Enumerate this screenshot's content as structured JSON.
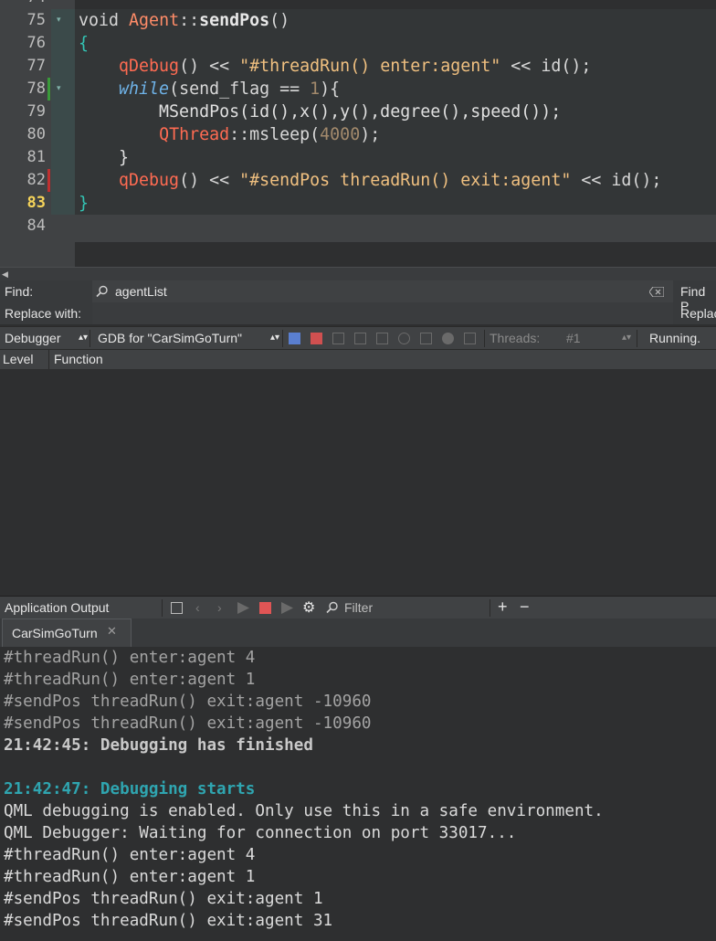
{
  "editor": {
    "prev_line_number": "74",
    "lines": [
      {
        "n": "75"
      },
      {
        "n": "76"
      },
      {
        "n": "77"
      },
      {
        "n": "78"
      },
      {
        "n": "79"
      },
      {
        "n": "80"
      },
      {
        "n": "81"
      },
      {
        "n": "82"
      },
      {
        "n": "83"
      },
      {
        "n": "84"
      }
    ],
    "current_line": "83",
    "code": {
      "l75_void": "void",
      "l75_class": "Agent",
      "l75_sep": "::",
      "l75_fn": "sendPos",
      "l75_paren": "()",
      "l76_brace": "{",
      "l77_indent": "    ",
      "l77_qdebug": "qDebug",
      "l77_mid": "() << ",
      "l77_str": "\"#threadRun() enter:agent\"",
      "l77_tail": " << id();",
      "l78_indent": "    ",
      "l78_while": "while",
      "l78_mid": "(send_flag == ",
      "l78_num": "1",
      "l78_tail": "){",
      "l79_text": "        MSendPos(id(),x(),y(),degree(),speed());",
      "l80_indent": "        ",
      "l80_class": "QThread",
      "l80_mid": "::msleep(",
      "l80_num": "4000",
      "l80_tail": ");",
      "l81_text": "    }",
      "l82_indent": "    ",
      "l82_qdebug": "qDebug",
      "l82_mid": "() << ",
      "l82_str": "\"#sendPos threadRun() exit:agent\"",
      "l82_tail": " << id();",
      "l83_brace": "}"
    }
  },
  "find": {
    "find_label": "Find:",
    "find_value": "agentList",
    "replace_label": "Replace with:",
    "find_prev_label": "Find P",
    "replace_btn_label": "Replac"
  },
  "debugger": {
    "view_selector": "Debugger",
    "engine_selector": "GDB for \"CarSimGoTurn\"",
    "threads_label": "Threads:",
    "thread_value": "#1",
    "status": "Running.",
    "col_level": "Level",
    "col_function": "Function"
  },
  "output": {
    "pane_title": "Application Output",
    "filter_placeholder": "Filter",
    "tab_label": "CarSimGoTurn",
    "lines": [
      {
        "text": "#threadRun() enter:agent 4",
        "style": "old"
      },
      {
        "text": "#threadRun() enter:agent 1",
        "style": "old"
      },
      {
        "text": "#sendPos threadRun() exit:agent -10960",
        "style": "old"
      },
      {
        "text": "#sendPos threadRun() exit:agent -10960",
        "style": "old"
      },
      {
        "text": "21:42:45: Debugging has finished",
        "style": "fin"
      },
      {
        "text": "",
        "style": "norm"
      },
      {
        "text": "21:42:47: Debugging starts",
        "style": "start"
      },
      {
        "text": "QML debugging is enabled. Only use this in a safe environment.",
        "style": "norm"
      },
      {
        "text": "QML Debugger: Waiting for connection on port 33017...",
        "style": "norm"
      },
      {
        "text": "#threadRun() enter:agent 4",
        "style": "norm"
      },
      {
        "text": "#threadRun() enter:agent 1",
        "style": "norm"
      },
      {
        "text": "#sendPos threadRun() exit:agent 1",
        "style": "norm"
      },
      {
        "text": "#sendPos threadRun() exit:agent 31",
        "style": "norm"
      }
    ]
  },
  "colors": {
    "accent_current_line": "#f5d35a",
    "debug_start": "#2fa5b0",
    "stop_red": "#e05555"
  },
  "icons": [
    "search-icon",
    "clear-icon",
    "fold-arrow-icon",
    "stop-icon",
    "settings-icon",
    "plus-icon",
    "minus-icon",
    "close-icon"
  ]
}
